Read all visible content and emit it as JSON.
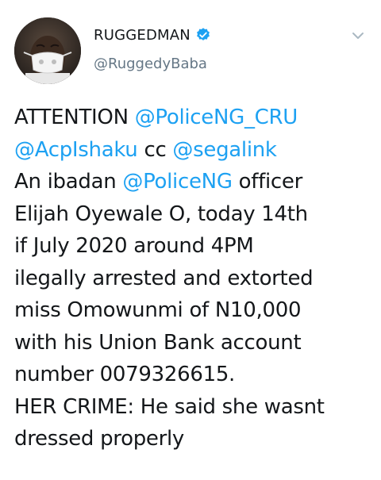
{
  "author": {
    "display_name": "RUGGEDMAN",
    "handle": "@RuggedyBaba",
    "verified": true,
    "avatar_icon": "avatar-photo-face-mask"
  },
  "menu": {
    "icon": "chevron-down-icon"
  },
  "colors": {
    "link": "#1da1f2",
    "text": "#14171a",
    "muted": "#657786"
  },
  "tweet": {
    "l1_t1": "ATTENTION ",
    "l1_m1": "@PoliceNG_CRU",
    "l2_m1": "@AcpIshaku",
    "l2_t1": " cc ",
    "l2_m2": "@segalink",
    "l3_t1": "An ibadan ",
    "l3_m1": "@PoliceNG",
    "l3_t2": " officer",
    "l4": "Elijah Oyewale O, today 14th",
    "l5": "if July 2020 around 4PM",
    "l6": "ilegally arrested and extorted",
    "l7": "miss Omowunmi of N10,000",
    "l8": "with his Union Bank account",
    "l9": "number 0079326615.",
    "l10": "HER CRIME: He said she wasnt",
    "l11": "dressed properly"
  }
}
